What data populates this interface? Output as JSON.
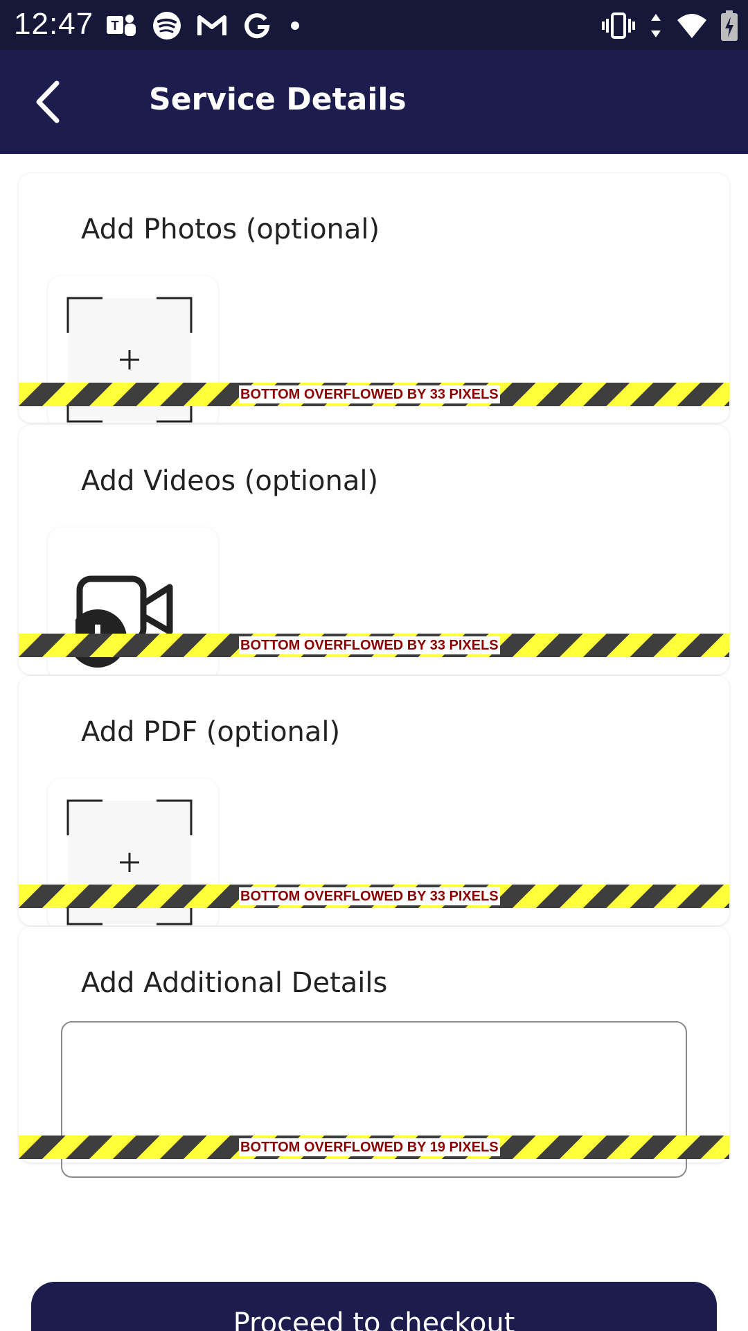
{
  "status_bar": {
    "time": "12:47",
    "left_icons": [
      "teams-icon",
      "spotify-icon",
      "gmail-icon",
      "google-icon",
      "dot-icon"
    ],
    "right_icons": [
      "vibrate-icon",
      "data-arrows-icon",
      "wifi-icon",
      "battery-charging-icon"
    ]
  },
  "app_bar": {
    "title": "Service Details",
    "back_icon": "arrow-back-icon",
    "background": "#1c1d4e"
  },
  "sections": {
    "photos": {
      "title": "Add Photos (optional)",
      "overflow_text": "BOTTOM OVERFLOWED BY 33 PIXELS"
    },
    "videos": {
      "title": "Add Videos (optional)",
      "overflow_text": "BOTTOM OVERFLOWED BY 33 PIXELS"
    },
    "pdf": {
      "title": "Add PDF (optional)",
      "overflow_text": "BOTTOM OVERFLOWED BY 33 PIXELS"
    },
    "details": {
      "title": "Add Additional Details",
      "overflow_text": "BOTTOM OVERFLOWED BY 19 PIXELS",
      "value": ""
    }
  },
  "footer": {
    "proceed_label": "Proceed to checkout"
  },
  "colors": {
    "primary": "#1c1d4e",
    "status_bar": "#151838",
    "overflow_yellow": "#ffff3a",
    "overflow_dark": "#3e3e3e",
    "overflow_text": "#8b0000"
  }
}
